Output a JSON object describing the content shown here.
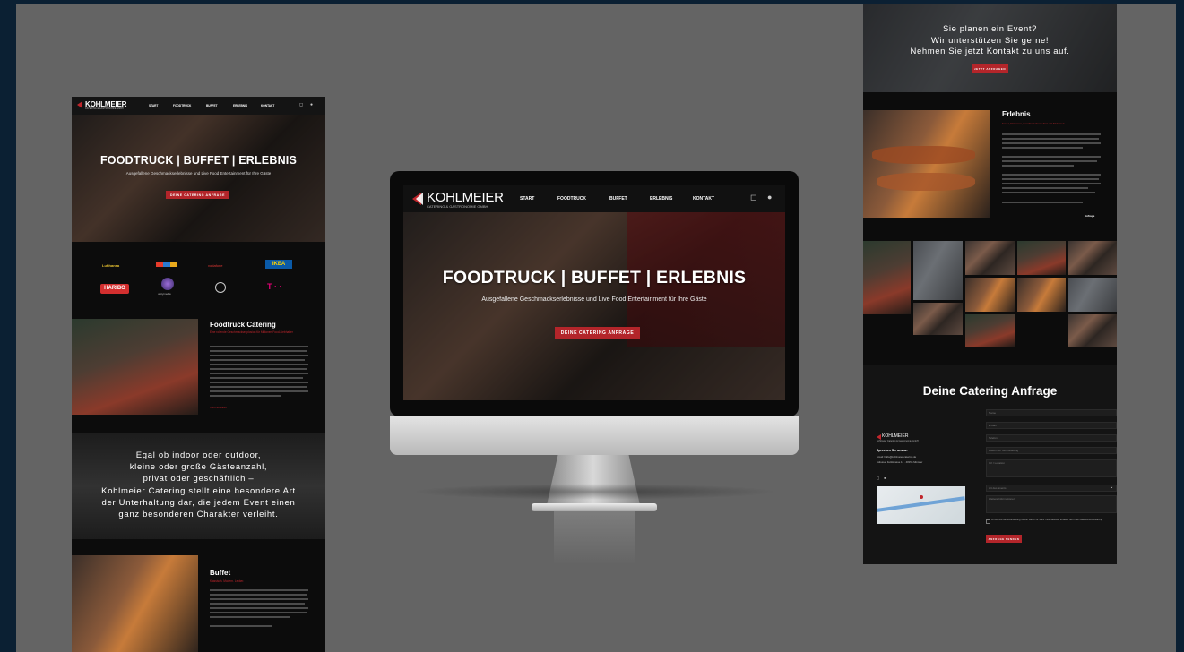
{
  "brand": {
    "name": "KOHLMEIER",
    "tagline": "CATERING & GASTRONOMIE GMBH"
  },
  "nav": [
    "START",
    "FOODTRUCK",
    "BUFFET",
    "ERLEBNIS",
    "KONTAKT"
  ],
  "hero": {
    "title": "FOODTRUCK | BUFFET | ERLEBNIS",
    "subtitle": "Ausgefallene Geschmackserlebnisse und Live Food Entertainment für Ihre Gäste",
    "cta": "DEINE CATERING ANFRAGE"
  },
  "partners": [
    "Lufthansa",
    "HARIBO",
    "vodafone",
    "IKEA",
    "unitymedia",
    "T · ·"
  ],
  "foodtruck": {
    "title": "Foodtruck Catering",
    "subtitle": "Eine rollende Geschmacksexplosion für Millionen Food-Liebhaber",
    "more": "mehr erfahren"
  },
  "quote": {
    "lines": [
      "Egal ob indoor oder outdoor,",
      "kleine oder große Gästeanzahl,",
      "privat oder geschäftlich –",
      "Kohlmeier Catering stellt eine besondere Art",
      "der Unterhaltung dar, die jedem Event einen",
      "ganz besonderen Charakter verleiht."
    ]
  },
  "buffet": {
    "title": "Buffet",
    "subtitle": "Klassisch. Modern. Lecker."
  },
  "event_banner": {
    "lines": [
      "Sie planen ein Event?",
      "Wir unterstützen Sie gerne!",
      "Nehmen Sie jetzt Kontakt zu uns auf."
    ],
    "cta": "JETZT ANFRAGEN"
  },
  "erlebnis": {
    "title": "Erlebnis",
    "subtitle": "Feuer, Flammen, Geschmackserlebnis mit Mehrwert",
    "highlight": "Anfrage"
  },
  "contact_form": {
    "title": "Deine Catering Anfrage",
    "fields": [
      "Name",
      "E-Mail",
      "Telefon",
      "Datum der Veranstaltung",
      "Ort / Location",
      "Art des Events",
      "Anzahl Personen",
      "Weitere Informationen"
    ],
    "consent": "Ich stimme der Verarbeitung meiner Daten zu. Mehr Informationen erhalten Sie in der Datenschutzerklärung",
    "consent_link": "Datenschutzerklärung",
    "submit": "ANFRAGE SENDEN",
    "company_name": "Kohlmeier Catering & Gastronomie GmbH",
    "contact_heading": "Sprechen Sie uns an",
    "contact_lines": [
      "Email: hallo@kohlmeier-catering.de",
      "Adresse: Feldstrasse 12 · 48155 Münster"
    ]
  },
  "icons": {
    "instagram": "instagram-icon",
    "facebook": "facebook-icon"
  },
  "colors": {
    "accent": "#c0262c",
    "dark": "#0c0c0c",
    "backdrop": "#646464",
    "frame": "#0b2033"
  }
}
